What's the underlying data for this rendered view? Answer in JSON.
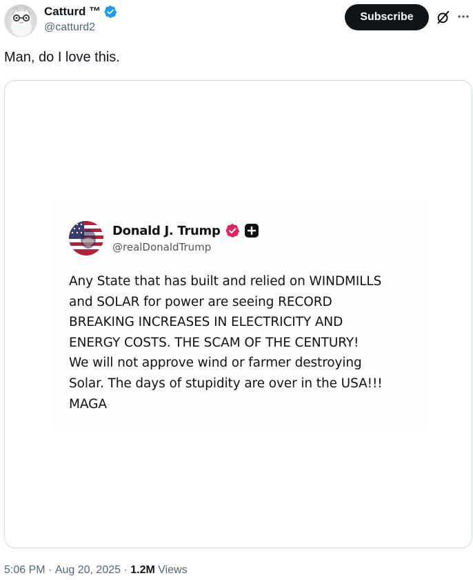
{
  "author": {
    "display_name": "Catturd ™",
    "handle": "@catturd2",
    "avatar_icon": "cat-avatar",
    "verified_icon": "verified-badge-icon",
    "verified_color": "#1d9bf0"
  },
  "actions": {
    "subscribe_label": "Subscribe",
    "grok_icon": "grok-icon",
    "more_icon": "more-icon"
  },
  "tweet": {
    "text": "Man, do I love this."
  },
  "quoted_image": {
    "author_name": "Donald J. Trump",
    "author_handle": "@realDonaldTrump",
    "verified_color": "#e0245e",
    "body": "Any State that has built and relied on WINDMILLS\nand SOLAR for power are seeing RECORD\nBREAKING INCREASES IN ELECTRICITY AND\nENERGY COSTS. THE SCAM OF THE CENTURY!\nWe will not approve wind or farmer destroying\nSolar. The days of stupidity are over in the USA!!!\nMAGA"
  },
  "meta": {
    "time": "5:06 PM",
    "separator": " · ",
    "date": "Aug 20, 2025",
    "views_count": "1.2M",
    "views_label": " Views"
  }
}
